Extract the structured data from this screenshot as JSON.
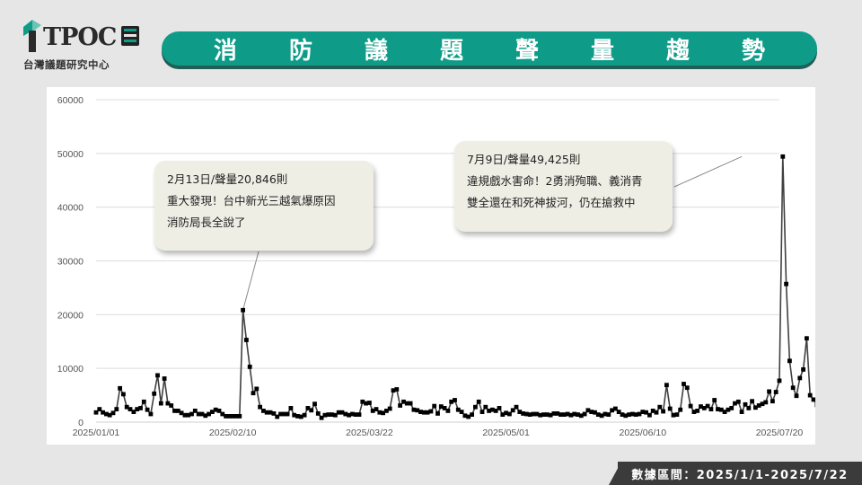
{
  "logo": {
    "brand": "TPOC",
    "org_name": "台灣議題研究中心"
  },
  "banner": {
    "title": "消防議題聲量趨勢"
  },
  "footer": {
    "date_range": "數據區間：2025/1/1-2025/7/22"
  },
  "colors": {
    "accent": "#0e9c88",
    "line": "#404040",
    "marker": "#000000",
    "callout_bg": "#efeee5"
  },
  "chart_data": {
    "type": "line",
    "title": "",
    "xlabel": "",
    "ylabel": "",
    "ylim": [
      0,
      60000
    ],
    "yticks": [
      0,
      10000,
      20000,
      30000,
      40000,
      50000,
      60000
    ],
    "xticks": [
      "2025/01/01",
      "2025/02/10",
      "2025/03/22",
      "2025/05/01",
      "2025/06/10",
      "2025/07/20"
    ],
    "grid": true,
    "legend": "none",
    "start_date": "2025-01-01",
    "end_date": "2025-07-22",
    "series": [
      {
        "name": "",
        "values": [
          1800,
          2400,
          1800,
          1500,
          1300,
          1700,
          2400,
          6300,
          5200,
          2800,
          2400,
          1900,
          2400,
          2600,
          3800,
          2300,
          1500,
          5300,
          8700,
          3500,
          8100,
          3500,
          3100,
          2100,
          2100,
          1700,
          1300,
          1300,
          1500,
          2100,
          1500,
          1500,
          1200,
          1500,
          1900,
          2300,
          2100,
          1500,
          1100,
          1100,
          1100,
          1100,
          1100,
          20846,
          15300,
          10300,
          5400,
          6200,
          2800,
          2100,
          1800,
          1800,
          1600,
          1000,
          1500,
          1500,
          1500,
          2600,
          1300,
          1100,
          1000,
          1300,
          2600,
          2200,
          3400,
          1600,
          800,
          1300,
          1400,
          1400,
          1300,
          1800,
          1800,
          1500,
          1300,
          1500,
          1400,
          1400,
          3800,
          3500,
          3600,
          2100,
          2400,
          1800,
          1700,
          2100,
          2500,
          5900,
          6100,
          3100,
          3800,
          3500,
          3500,
          2300,
          2200,
          1900,
          1800,
          1800,
          2000,
          3000,
          1600,
          2900,
          2600,
          2100,
          3800,
          4100,
          2300,
          1900,
          1200,
          1000,
          1400,
          2800,
          3800,
          1900,
          2800,
          2100,
          2300,
          2100,
          2600,
          1400,
          1700,
          1500,
          2200,
          2800,
          1900,
          1600,
          1500,
          1400,
          1500,
          1500,
          1300,
          1400,
          1400,
          1300,
          1600,
          1600,
          1400,
          1400,
          1500,
          1300,
          1500,
          1400,
          1200,
          1500,
          2200,
          1900,
          1800,
          1400,
          1200,
          1500,
          1400,
          2200,
          2500,
          1900,
          1400,
          1200,
          1400,
          1500,
          1400,
          1500,
          1900,
          1800,
          1300,
          2100,
          1800,
          2800,
          2000,
          6900,
          2500,
          1300,
          1400,
          2300,
          7100,
          6400,
          3000,
          1900,
          2100,
          2900,
          2600,
          3000,
          2400,
          4100,
          2400,
          2300,
          1900,
          2300,
          2600,
          3500,
          3800,
          1900,
          3300,
          2600,
          3900,
          2700,
          3100,
          3400,
          3700,
          5700,
          3900,
          5600,
          7700,
          49425,
          25700,
          11400,
          6400,
          4900,
          8200,
          9800,
          15600,
          5000,
          4200,
          3200,
          3400,
          3000,
          3500
        ]
      }
    ],
    "annotations": [
      {
        "date": "2025/02/13",
        "value": 20846,
        "lines": [
          "2月13日/聲量20,846則",
          "重大發現！台中新光三越氣爆原因",
          "消防局長全說了"
        ]
      },
      {
        "date": "2025/07/09",
        "value": 49425,
        "lines": [
          "7月9日/聲量49,425則",
          "違規戲水害命！2勇消殉職、義消青",
          "雙全還在和死神拔河，仍在搶救中"
        ]
      }
    ]
  }
}
